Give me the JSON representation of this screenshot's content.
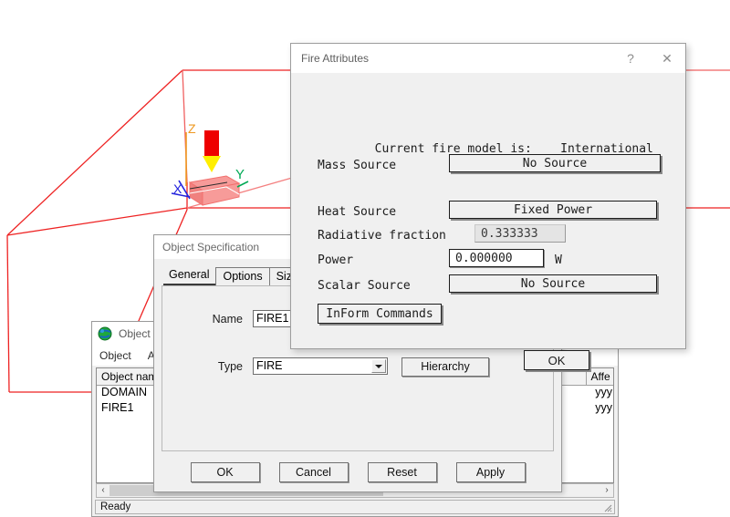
{
  "viewport": {
    "axis_labels": {
      "x": "X",
      "y": "Y",
      "z": "Z"
    }
  },
  "object_management": {
    "title": "Object M",
    "icon": "globe-icon",
    "menus": [
      "Object",
      "Act"
    ],
    "columns": [
      "Object name",
      "e",
      "Affe"
    ],
    "rows": [
      {
        "name": "DOMAIN",
        "middle": "",
        "affects": "yyy"
      },
      {
        "name": "FIRE1",
        "middle": "",
        "affects": "yyy"
      }
    ],
    "status": "Ready",
    "scroll_left_arrow": "‹",
    "scroll_right_arrow": "›"
  },
  "object_specification": {
    "title": "Object Specification",
    "tabs": [
      {
        "label": "General",
        "active": true
      },
      {
        "label": "Options",
        "active": false
      },
      {
        "label": "Size",
        "active": false
      }
    ],
    "fields": {
      "name_label": "Name",
      "name_value": "FIRE1",
      "type_label": "Type",
      "type_value": "FIRE"
    },
    "hierarchy_button": "Hierarchy",
    "buttons": [
      "OK",
      "Cancel",
      "Reset",
      "Apply"
    ]
  },
  "fire_attributes": {
    "title": "Fire Attributes",
    "help_button": "?",
    "close_button": "✕",
    "model_label": "Current fire model is:",
    "model_value": "International",
    "mass_source_label": "Mass Source",
    "mass_source_value": "No Source",
    "heat_source_label": "Heat Source",
    "heat_source_value": "Fixed Power",
    "radiative_fraction_label": "Radiative fraction",
    "radiative_fraction_value": "0.333333",
    "power_label": "Power",
    "power_value": "0.000000",
    "power_unit": "W",
    "scalar_source_label": "Scalar Source",
    "scalar_source_value": "No Source",
    "inform_button": "InForm Commands",
    "ok_button": "OK"
  },
  "colors": {
    "wireframe_red": "#ee2222",
    "object_fill": "#f79b99",
    "axis_x": "#2222dd",
    "axis_y": "#00aa55",
    "axis_z": "#ee9922",
    "fire_red": "#ee0000",
    "fire_yellow": "#ffee00",
    "dialog_bg": "#f0f0f0"
  }
}
